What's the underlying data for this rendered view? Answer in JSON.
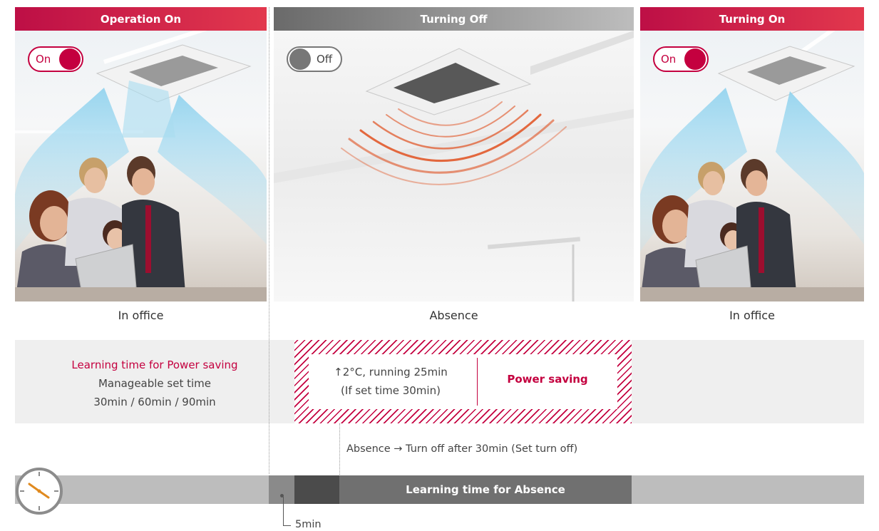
{
  "panels": [
    {
      "header": "Operation On",
      "toggle": "On",
      "caption": "In office"
    },
    {
      "header": "Turning Off",
      "toggle": "Off",
      "caption": "Absence"
    },
    {
      "header": "Turning On",
      "toggle": "On",
      "caption": "In office"
    }
  ],
  "learning": {
    "title": "Learning time for Power saving",
    "line2": "Manageable set time",
    "line3": "30min / 60min / 90min"
  },
  "power_saving": {
    "line1": "↑2°C, running 25min",
    "line2": "(If set time 30min)",
    "label": "Power saving"
  },
  "absence_note": "Absence → Turn off after 30min (Set turn off)",
  "timeline": {
    "absence_label": "Learning time for Absence",
    "marker": "5min"
  },
  "colors": {
    "accent": "#c4003f",
    "gray_dark": "#4b4b4b",
    "gray_bar": "#bdbdbd"
  }
}
